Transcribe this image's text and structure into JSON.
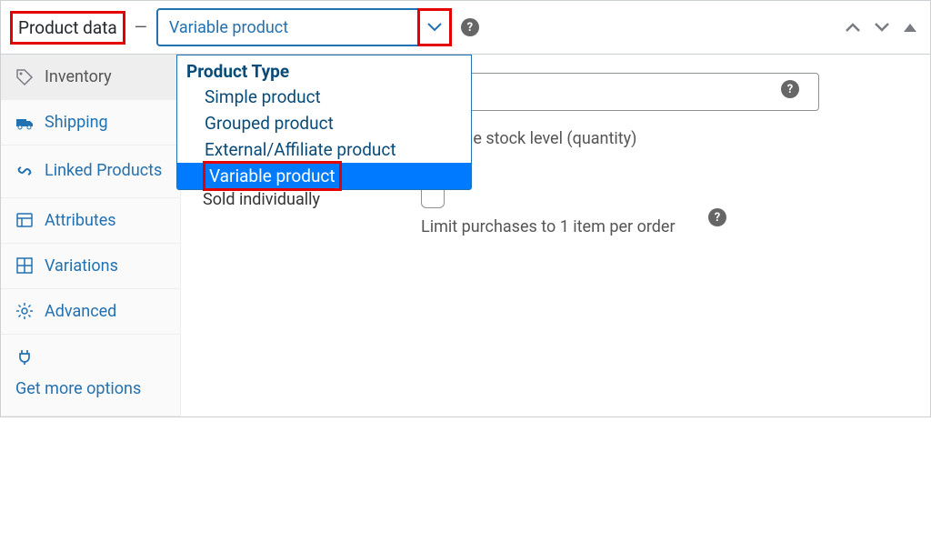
{
  "header": {
    "title": "Product data",
    "selected_product_type": "Variable product",
    "dropdown": {
      "group_label": "Product Type",
      "options": [
        "Simple product",
        "Grouped product",
        "External/Affiliate product",
        "Variable product"
      ],
      "selected_index": 3
    }
  },
  "sidebar": {
    "items": [
      {
        "label": "Inventory",
        "icon": "tag"
      },
      {
        "label": "Shipping",
        "icon": "truck"
      },
      {
        "label": "Linked Products",
        "icon": "link"
      },
      {
        "label": "Attributes",
        "icon": "list"
      },
      {
        "label": "Variations",
        "icon": "grid"
      },
      {
        "label": "Advanced",
        "icon": "gear"
      },
      {
        "label": "Get more options",
        "icon": "plug"
      }
    ]
  },
  "form": {
    "manage_stock_desc": "Manage stock level (quantity)",
    "sold_individually_label": "Sold individually",
    "sold_individually_desc": "Limit purchases to 1 item per order"
  }
}
